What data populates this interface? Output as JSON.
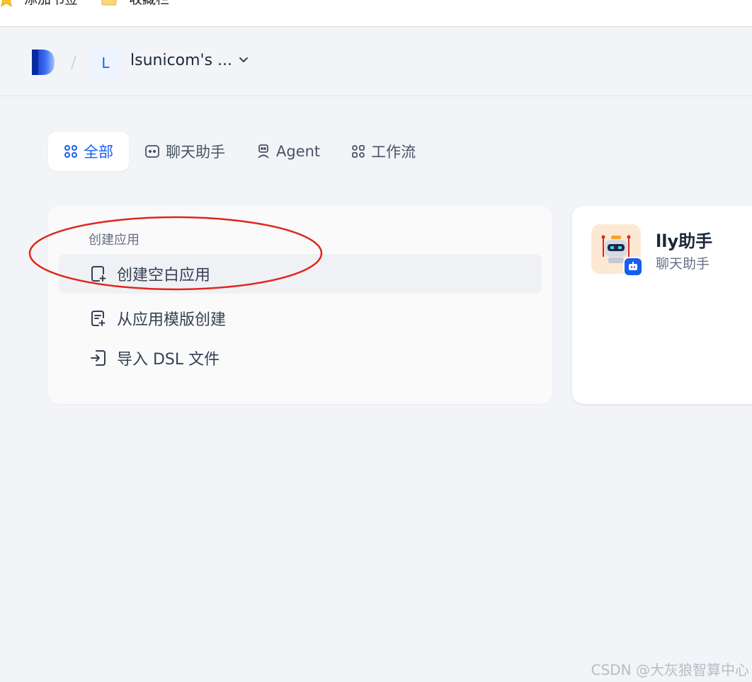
{
  "bookmarks_bar": {
    "add_bookmark": "添加书签",
    "favorites": "收藏栏"
  },
  "header": {
    "workspace_initial": "L",
    "workspace_name": "lsunicom's ..."
  },
  "tabs": [
    {
      "label": "全部",
      "icon": "grid-icon",
      "active": true
    },
    {
      "label": "聊天助手",
      "icon": "chat-icon",
      "active": false
    },
    {
      "label": "Agent",
      "icon": "agent-icon",
      "active": false
    },
    {
      "label": "工作流",
      "icon": "workflow-icon",
      "active": false
    }
  ],
  "create_card": {
    "title": "创建应用",
    "options": [
      {
        "label": "创建空白应用",
        "icon": "new-file-icon"
      },
      {
        "label": "从应用模版创建",
        "icon": "template-icon"
      },
      {
        "label": "导入 DSL 文件",
        "icon": "import-icon"
      }
    ]
  },
  "app_card": {
    "name": "lly助手",
    "type": "聊天助手"
  },
  "watermark": "CSDN @大灰狼智算中心",
  "colors": {
    "accent": "#155eef",
    "annotation": "#e0261b",
    "page_bg": "#f2f4f7"
  }
}
